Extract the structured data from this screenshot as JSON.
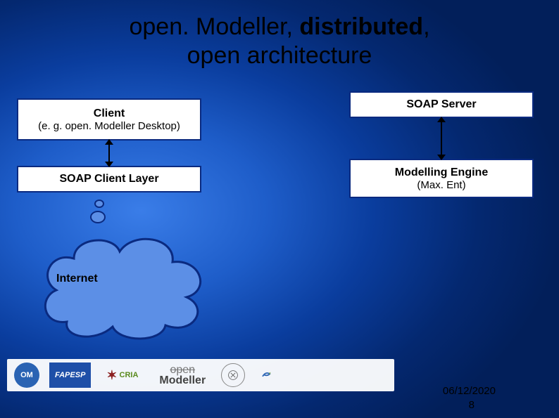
{
  "title": {
    "line1_a": "open. Modeller, ",
    "line1_b": "distributed",
    "line1_c": ",",
    "line2": "open architecture"
  },
  "boxes": {
    "client": {
      "label": "Client",
      "sub": "(e. g. open. Modeller Desktop)"
    },
    "soapClient": {
      "label": "SOAP Client Layer"
    },
    "soapServer": {
      "label": "SOAP Server"
    },
    "engine": {
      "label": "Modelling Engine",
      "sub": "(Max. Ent)"
    }
  },
  "cloud": {
    "label": "Internet"
  },
  "logos": {
    "om": "OM",
    "fapesp": "FAPESP",
    "cria": "CRIA",
    "openModeller_a": "open",
    "openModeller_b": "Modeller"
  },
  "footer": {
    "date": "06/12/2020",
    "page": "8"
  },
  "colors": {
    "border": "#0a2a80",
    "bg": "#ffffff",
    "accent": "#5c8fe6"
  }
}
